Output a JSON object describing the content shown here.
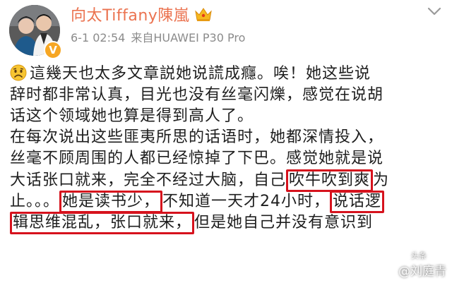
{
  "header": {
    "username": "向太Tiffany陳嵐",
    "badge_icon": "crown-icon",
    "verified_icon": "verified-v-icon",
    "verified_glyph": "V",
    "timestamp": "6-1 02:54",
    "source_prefix": "来自",
    "source_device": "HUAWEI P30 Pro",
    "menu_icon": "chevron-down-icon"
  },
  "post": {
    "emoji_icon": "sad-face-emoji-icon",
    "line1": "這幾天也太多文章説她说謊成癮。唉！她这些说",
    "line2": "辞时都非常认真，目光也没有丝毫闪爍，感觉在说胡",
    "line3": "话这个领域她也算是得到高人了。",
    "line4": "在每次说出这些匪夷所思的话语时，她都深情投入，",
    "line5": "丝毫不顾周围的人都已经惊掉了下巴。感觉她就是说",
    "line6_pre": "大话张口就来，完全不经过大脑，自己",
    "line6_hl": "吹牛吹到爽",
    "line6_post": "为",
    "line7_pre": "止。。。",
    "line7_hl1": "她是读书少，",
    "line7_mid": "不知道一天才24小时，",
    "line7_hl2": "说话逻",
    "line8_hl": "辑思维混乱，张口就来，",
    "line8_post": "但是她自己并没有意识到"
  },
  "watermark": {
    "ribbon": "头条",
    "text": "@刘庭青",
    "logo_icon": "toutiao-logo-icon"
  },
  "colors": {
    "username": "#eb7350",
    "meta": "#8b8b8b",
    "highlight_box": "#d6121d",
    "verified": "#f6a623"
  }
}
